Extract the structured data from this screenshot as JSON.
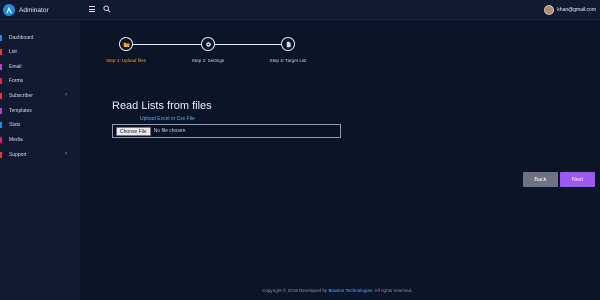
{
  "brand": {
    "name": "Adminator"
  },
  "header": {
    "user_email": "khan@gmail.com"
  },
  "sidebar": {
    "items": [
      {
        "label": "Dashboard",
        "color": "#1e88e5",
        "chevron": false
      },
      {
        "label": "List",
        "color": "#e53935",
        "chevron": false
      },
      {
        "label": "Email",
        "color": "#ab47bc",
        "chevron": false
      },
      {
        "label": "Forms",
        "color": "#e91e63",
        "chevron": false
      },
      {
        "label": "Subscriber",
        "color": "#e53935",
        "chevron": true
      },
      {
        "label": "Templates",
        "color": "#ab47bc",
        "chevron": false
      },
      {
        "label": "Stats",
        "color": "#1e88e5",
        "chevron": false
      },
      {
        "label": "Media",
        "color": "#e91e63",
        "chevron": false
      },
      {
        "label": "Support",
        "color": "#e53935",
        "chevron": true
      }
    ]
  },
  "stepper": {
    "steps": [
      {
        "label": "Step 1: Upload files",
        "active": true,
        "icon": "folder-icon"
      },
      {
        "label": "Step 2: Settings",
        "active": false,
        "icon": "gear-icon"
      },
      {
        "label": "Step 3: Target List",
        "active": false,
        "icon": "file-icon"
      }
    ],
    "active_color": "#f5a623",
    "inactive_color": "#d7dbe6"
  },
  "main": {
    "title": "Read Lists from files",
    "upload_hint": "Upload Excel or Csv File",
    "choose_file_label": "Choose File",
    "no_file_text": "No file chosen",
    "back_label": "Back",
    "next_label": "Next"
  },
  "footer": {
    "prefix": "Copyright © 2019 Developed by ",
    "company": "Braxton Technologies",
    "suffix": ". All rights reserved."
  }
}
